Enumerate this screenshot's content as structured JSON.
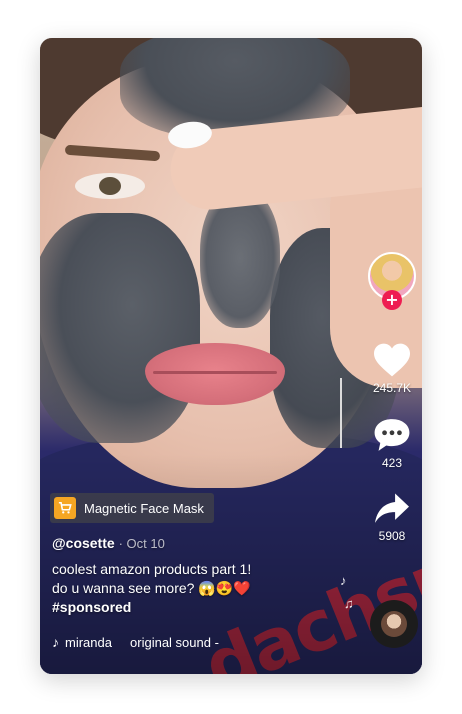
{
  "post": {
    "username": "@cosette",
    "date": "· Oct 10",
    "caption_line1": "coolest amazon products part 1!",
    "caption_line2": "do u wanna see more? 😱😍❤️",
    "hashtag": "#sponsored",
    "sound_text": "miranda     original sound -"
  },
  "ad": {
    "label": "Magnetic Face Mask"
  },
  "actions": {
    "likes": "245.7K",
    "comments": "423",
    "shares": "5908"
  },
  "colors": {
    "follow": "#ee1d52",
    "cart": "#f5a623"
  }
}
